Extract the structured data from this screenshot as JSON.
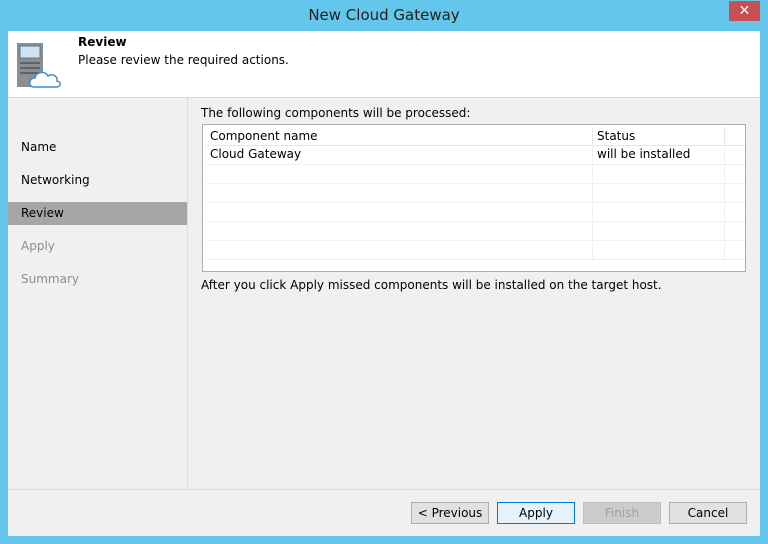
{
  "window": {
    "title": "New Cloud Gateway",
    "close_glyph": "✕"
  },
  "header": {
    "title": "Review",
    "subtitle": "Please review the required actions.",
    "icon": "server-cloud-icon"
  },
  "sidebar": {
    "items": [
      {
        "label": "Name",
        "state": "normal"
      },
      {
        "label": "Networking",
        "state": "normal"
      },
      {
        "label": "Review",
        "state": "active"
      },
      {
        "label": "Apply",
        "state": "disabled"
      },
      {
        "label": "Summary",
        "state": "disabled"
      }
    ]
  },
  "main": {
    "intro": "The following components will be processed:",
    "table": {
      "columns": [
        "Component name",
        "Status"
      ],
      "rows": [
        [
          "Cloud Gateway",
          "will be installed"
        ]
      ]
    },
    "footnote": "After you click Apply missed components will be installed on the target host."
  },
  "footer": {
    "previous": "< Previous",
    "apply": "Apply",
    "finish": "Finish",
    "cancel": "Cancel"
  },
  "colors": {
    "titlebar": "#63c6ea",
    "close": "#c75050",
    "active_nav": "#a6a6a6",
    "primary_border": "#0078d7"
  }
}
